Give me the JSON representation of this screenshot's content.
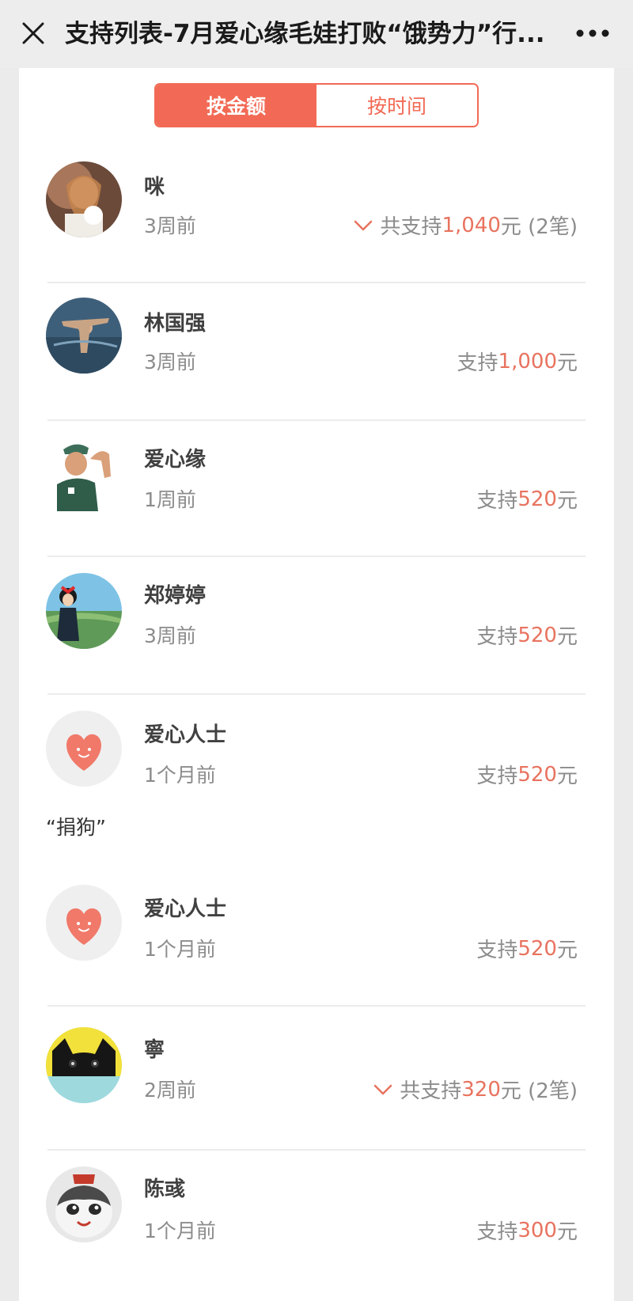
{
  "nav": {
    "title": "支持列表-7月爱心缘毛娃打败“饿势力”行...",
    "close_icon": "close-icon",
    "more_icon": "more-icon"
  },
  "tabs": [
    {
      "label": "按金额",
      "active": true
    },
    {
      "label": "按时间",
      "active": false
    }
  ],
  "colors": {
    "accent": "#f26a55",
    "amount": "#e8735f",
    "muted": "#8c8c8c"
  },
  "supporters": [
    {
      "name": "咪",
      "time": "3周前",
      "prefix": "共支持",
      "amount": "1,040",
      "unit": "元",
      "extra": "(2笔)",
      "expandable": true,
      "avatar": "photo-girl-with-cat"
    },
    {
      "name": "林国强",
      "time": "3周前",
      "prefix": "支持",
      "amount": "1,000",
      "unit": "元",
      "extra": "",
      "expandable": false,
      "avatar": "photo-man-in-water"
    },
    {
      "name": "爱心缘",
      "time": "1周前",
      "prefix": "支持",
      "amount": "520",
      "unit": "元",
      "extra": "",
      "expandable": false,
      "avatar": "illustration-man-with-cap"
    },
    {
      "name": "郑婷婷",
      "time": "3周前",
      "prefix": "支持",
      "amount": "520",
      "unit": "元",
      "extra": "",
      "expandable": false,
      "avatar": "illustration-witch-girl-landscape"
    },
    {
      "name": "爱心人士",
      "time": "1个月前",
      "prefix": "支持",
      "amount": "520",
      "unit": "元",
      "extra": "",
      "expandable": false,
      "avatar": "heart-smile-icon",
      "message": "“捐狗”"
    },
    {
      "name": "爱心人士",
      "time": "1个月前",
      "prefix": "支持",
      "amount": "520",
      "unit": "元",
      "extra": "",
      "expandable": false,
      "avatar": "heart-smile-icon"
    },
    {
      "name": "寧",
      "time": "2周前",
      "prefix": "共支持",
      "amount": "320",
      "unit": "元",
      "extra": "(2笔)",
      "expandable": true,
      "avatar": "black-cat-icon"
    },
    {
      "name": "陈彧",
      "time": "1个月前",
      "prefix": "支持",
      "amount": "300",
      "unit": "元",
      "extra": "",
      "expandable": false,
      "avatar": "cartoon-cat-icon"
    }
  ]
}
